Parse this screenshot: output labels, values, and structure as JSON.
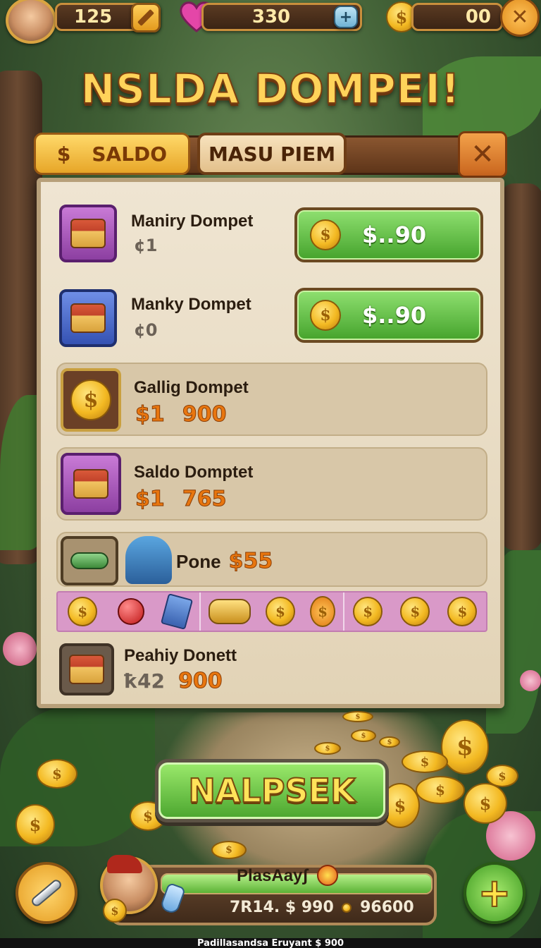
{
  "hud": {
    "coins_a": "125",
    "hearts": "330",
    "coins_b": "00"
  },
  "title": "NSLDA DOMPEI!",
  "tabs": {
    "saldo_icon": "$",
    "saldo_label": "SALDO",
    "masu_label": "MASU PIEM"
  },
  "items": [
    {
      "name": "Maniry Dompet",
      "sub": "¢1",
      "price": "$..90"
    },
    {
      "name": "Manky Dompet",
      "sub": "¢0",
      "price": "$..90"
    },
    {
      "name": "Gallig Dompet",
      "price_a": "$1",
      "price_b": "900"
    },
    {
      "name": "Saldo Domptet",
      "price_a": "$1",
      "price_b": "765"
    },
    {
      "name": "Pone",
      "price": "$55"
    },
    {
      "name": "Peahiy Donett",
      "price_a": "ҟ42",
      "price_b": "900"
    }
  ],
  "main_button": "NALPSEK",
  "player": {
    "name": "PlasAayʃ",
    "stats": "7R14. $ 990",
    "coins": "96600"
  },
  "footer": "Padillasandsa Eruyant $ 900",
  "colors": {
    "green_button": "#4aa52e",
    "gold": "#ffd35a",
    "panel": "#efe5d2"
  },
  "icons": [
    "coin-icon",
    "heart-icon",
    "pencil-icon",
    "plus-icon",
    "close-icon",
    "chest-icon",
    "wrench-icon",
    "sun-badge-icon"
  ]
}
